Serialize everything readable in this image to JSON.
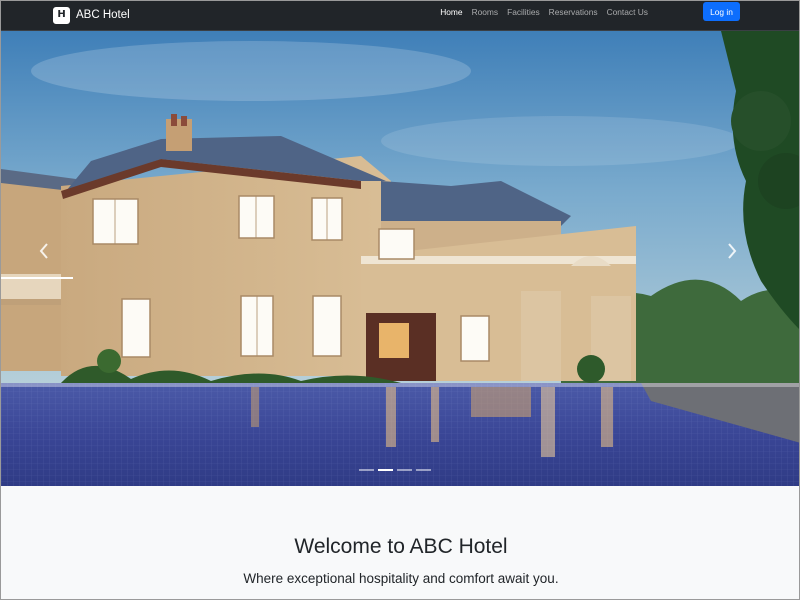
{
  "navbar": {
    "brand_logo_letter": "H",
    "brand_name": "ABC Hotel",
    "links": [
      "Home",
      "Rooms",
      "Facilities",
      "Reservations",
      "Contact Us"
    ],
    "active_link": "Home",
    "login_label": "Log in"
  },
  "carousel": {
    "slide_count": 4,
    "active_index": 1,
    "prev_icon": "chevron-left-icon",
    "next_icon": "chevron-right-icon"
  },
  "welcome": {
    "title": "Welcome to ABC Hotel",
    "subtitle": "Where exceptional hospitality and comfort await you."
  },
  "colors": {
    "navbar_bg": "#212529",
    "primary": "#0d6efd",
    "page_bg": "#f8f9fa"
  }
}
